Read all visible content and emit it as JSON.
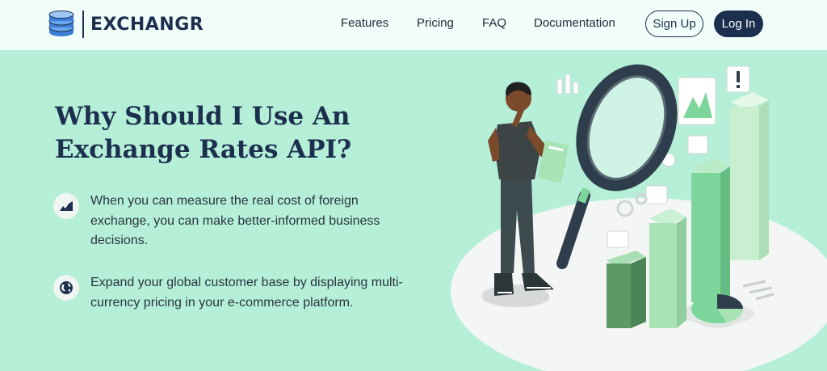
{
  "brand": {
    "name": "EXCHANGR",
    "logo_icon": "coin-stack-icon"
  },
  "nav": {
    "links": [
      "Features",
      "Pricing",
      "FAQ",
      "Documentation"
    ],
    "signup_label": "Sign Up",
    "login_label": "Log In"
  },
  "hero": {
    "headline": "Why Should I Use An Exchange Rates API?",
    "features": [
      {
        "icon": "rising-chart-icon",
        "text": "When you can measure the real cost of foreign exchange, you can make better-informed business decisions."
      },
      {
        "icon": "globe-icon",
        "text": "Expand your global customer base by displaying multi-currency pricing in your e-commerce platform."
      }
    ],
    "illustration": "analysis-magnifier-illustration"
  },
  "colors": {
    "navy": "#1d2f4e",
    "mint_background": "#b5efd7",
    "nav_background": "#f1fdf8",
    "accent_green": "#7cd59a"
  }
}
